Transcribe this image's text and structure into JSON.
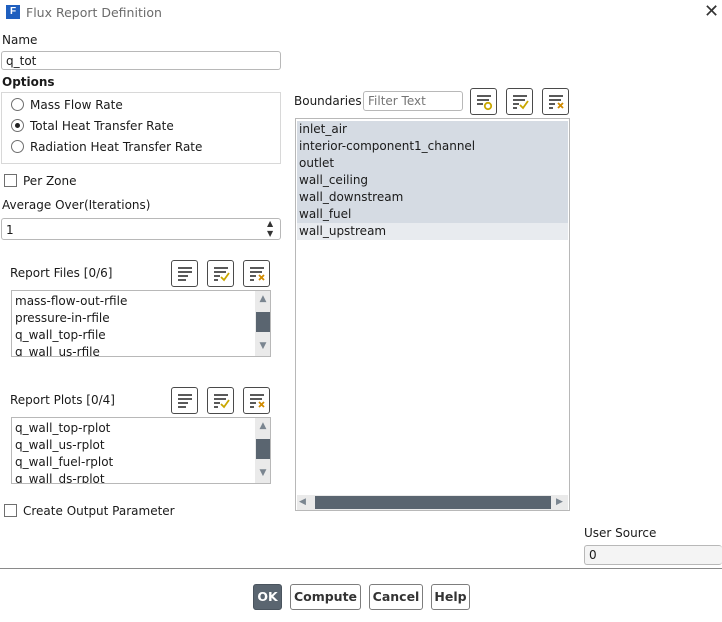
{
  "window": {
    "title": "Flux Report Definition",
    "app_icon": "F"
  },
  "name": {
    "label": "Name",
    "value": "q_tot"
  },
  "options": {
    "label": "Options",
    "items": [
      {
        "label": "Mass Flow Rate",
        "selected": false
      },
      {
        "label": "Total Heat Transfer Rate",
        "selected": true
      },
      {
        "label": "Radiation Heat Transfer Rate",
        "selected": false
      }
    ]
  },
  "per_zone": {
    "label": "Per Zone",
    "checked": false
  },
  "average_over": {
    "label": "Average Over(Iterations)",
    "value": "1"
  },
  "report_files": {
    "label": "Report Files",
    "count": "[0/6]",
    "items": [
      "mass-flow-out-rfile",
      "pressure-in-rfile",
      "q_wall_top-rfile",
      "q_wall_us-rfile"
    ]
  },
  "report_plots": {
    "label": "Report Plots",
    "count": "[0/4]",
    "items": [
      "q_wall_top-rplot",
      "q_wall_us-rplot",
      "q_wall_fuel-rplot",
      "q_wall_ds-rplot"
    ]
  },
  "create_output_parameter": {
    "label": "Create Output Parameter",
    "checked": false
  },
  "boundaries": {
    "label": "Boundaries",
    "filter_placeholder": "Filter Text",
    "items": [
      "inlet_air",
      "interior-component1_channel",
      "outlet",
      "wall_ceiling",
      "wall_downstream",
      "wall_fuel",
      "wall_upstream"
    ],
    "selected_count": 6
  },
  "user_source": {
    "label": "User Source",
    "value": "0"
  },
  "buttons": {
    "ok": "OK",
    "compute": "Compute",
    "cancel": "Cancel",
    "help": "Help"
  },
  "colors": {
    "selection": "#d5dbe3",
    "scroll_thumb": "#5a6570",
    "primary_button": "#5a6570",
    "app_icon": "#1f5fbf"
  }
}
